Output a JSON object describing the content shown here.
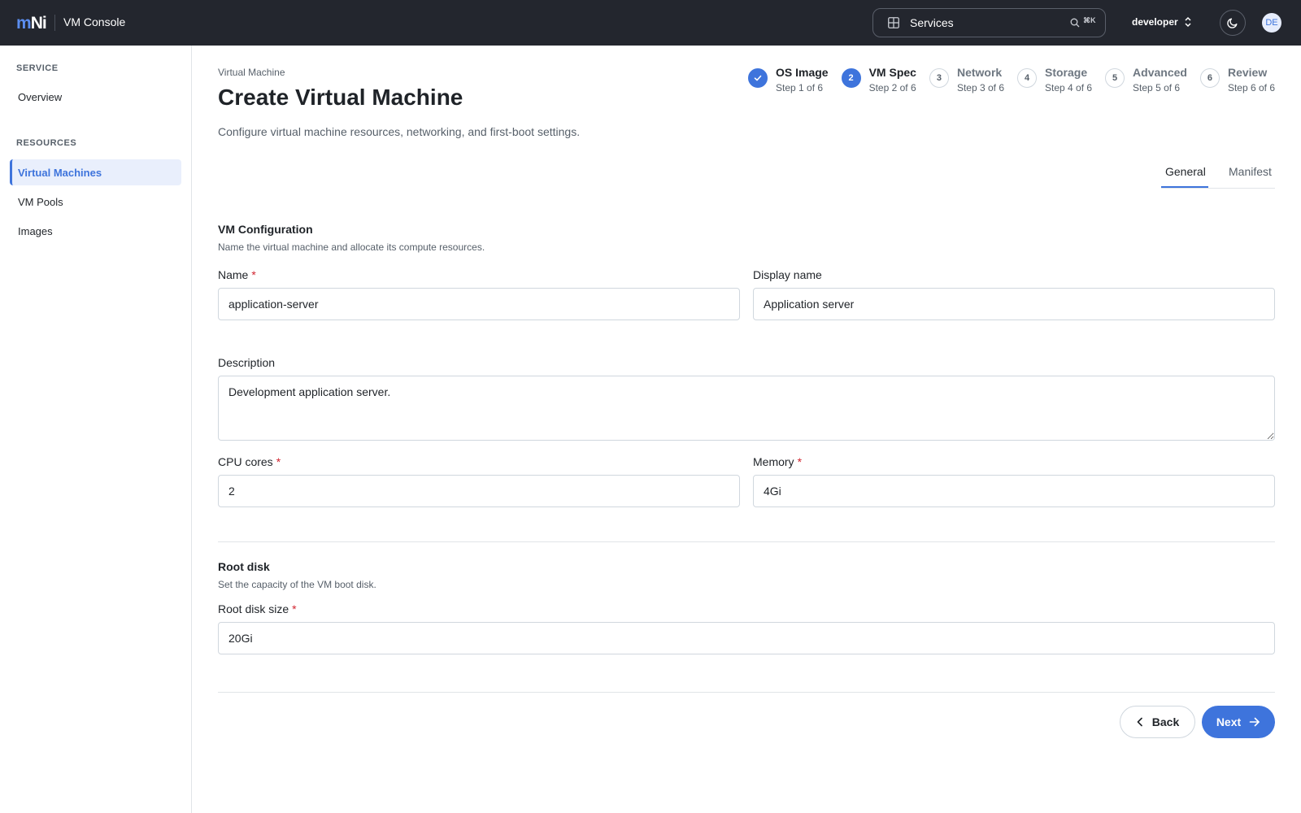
{
  "header": {
    "logo_m": "m",
    "logo_n": "Ni",
    "app_title": "VM Console",
    "services_label": "Services",
    "shortcut": "⌘K",
    "context": "developer",
    "avatar_initials": "DE"
  },
  "sidebar": {
    "service_heading": "SERVICE",
    "overview": "Overview",
    "resources_heading": "RESOURCES",
    "items": [
      {
        "label": "Virtual Machines",
        "active": true
      },
      {
        "label": "VM Pools",
        "active": false
      },
      {
        "label": "Images",
        "active": false
      }
    ]
  },
  "page": {
    "breadcrumb": "Virtual Machine",
    "title": "Create Virtual Machine",
    "subtitle": "Configure virtual machine resources, networking, and first-boot settings."
  },
  "steps": [
    {
      "num": "1",
      "title": "OS Image",
      "sub": "Step 1 of 6",
      "state": "done"
    },
    {
      "num": "2",
      "title": "VM Spec",
      "sub": "Step 2 of 6",
      "state": "current"
    },
    {
      "num": "3",
      "title": "Network",
      "sub": "Step 3 of 6",
      "state": "pending"
    },
    {
      "num": "4",
      "title": "Storage",
      "sub": "Step 4 of 6",
      "state": "pending"
    },
    {
      "num": "5",
      "title": "Advanced",
      "sub": "Step 5 of 6",
      "state": "pending"
    },
    {
      "num": "6",
      "title": "Review",
      "sub": "Step 6 of 6",
      "state": "pending"
    }
  ],
  "tabs": {
    "general": "General",
    "manifest": "Manifest",
    "active": "General"
  },
  "vm_config": {
    "title": "VM Configuration",
    "desc": "Name the virtual machine and allocate its compute resources.",
    "name_label": "Name",
    "name_value": "application-server",
    "display_label": "Display name",
    "display_value": "Application server",
    "desc_label": "Description",
    "desc_value": "Development application server.",
    "cpu_label": "CPU cores",
    "cpu_value": "2",
    "mem_label": "Memory",
    "mem_value": "4Gi",
    "required_mark": "*"
  },
  "root_disk": {
    "title": "Root disk",
    "desc": "Set the capacity of the VM boot disk.",
    "size_label": "Root disk size",
    "size_value": "20Gi"
  },
  "actions": {
    "back": "Back",
    "next": "Next"
  },
  "colors": {
    "accent": "#3e74dc",
    "topbar": "#23262e",
    "required": "#d1242f"
  }
}
